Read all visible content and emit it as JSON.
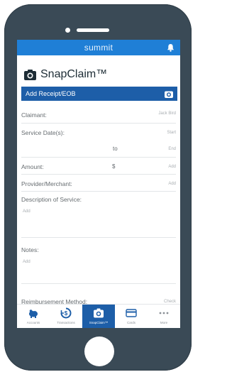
{
  "colors": {
    "phone_body": "#3a4a56",
    "app_bar": "#1f7fd6",
    "accent_dark": "#1d5ea8",
    "divider": "#e3e6e8"
  },
  "app_bar": {
    "brand": "summit",
    "bell_icon": "bell-icon"
  },
  "header": {
    "title": "SnapClaim™",
    "title_icon": "camera-icon"
  },
  "receipt_button": {
    "label": "Add Receipt/EOB",
    "icon": "camera-icon"
  },
  "form": {
    "claimant": {
      "label": "Claimant:",
      "value": "Jack Bird"
    },
    "service_dates": {
      "label": "Service Date(s):",
      "start_placeholder": "Start",
      "separator": "to",
      "end_placeholder": "End"
    },
    "amount": {
      "label": "Amount:",
      "currency": "$",
      "placeholder": "Add"
    },
    "provider": {
      "label": "Provider/Merchant:",
      "placeholder": "Add"
    },
    "description": {
      "label": "Description of Service:",
      "placeholder": "Add"
    },
    "notes": {
      "label": "Notes:",
      "placeholder": "Add"
    },
    "reimbursement": {
      "label": "Reimbursement Method:",
      "value": "Check"
    }
  },
  "tabs": [
    {
      "label": "Accounts",
      "icon": "piggy-bank-icon",
      "active": false
    },
    {
      "label": "Transactions",
      "icon": "refresh-dollar-icon",
      "active": false
    },
    {
      "label": "SnapClaim™",
      "icon": "camera-icon",
      "active": true
    },
    {
      "label": "Cards",
      "icon": "card-icon",
      "active": false
    },
    {
      "label": "More",
      "icon": "more-dots-icon",
      "active": false
    }
  ]
}
